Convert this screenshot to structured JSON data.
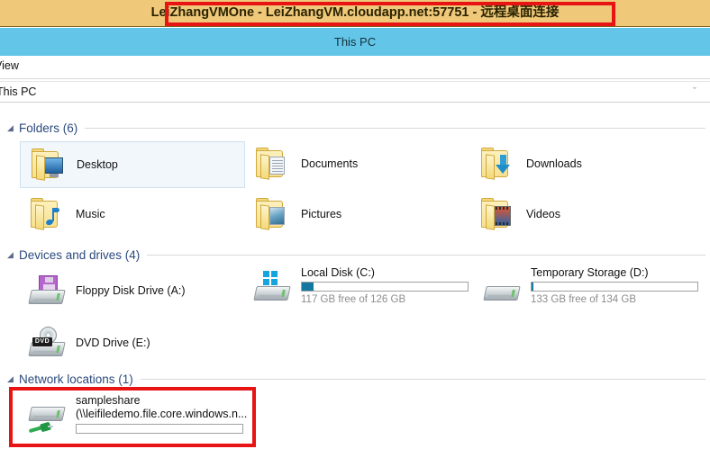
{
  "rdp": {
    "title": "LeiZhangVMOne - LeiZhangVM.cloudapp.net:57751 - 远程桌面连接",
    "highlight_color": "#e81414",
    "bar_color": "#efc87a"
  },
  "window": {
    "title": "This PC",
    "titlebar_color": "#63c6e8"
  },
  "ribbon": {
    "tab_label": "View"
  },
  "address_bar": {
    "path": "This PC",
    "chevron": "chevron-down-icon",
    "chevron_glyph": "ˇ"
  },
  "groups": [
    {
      "id": "folders",
      "label": "Folders (6)",
      "caret": "◢",
      "items": [
        {
          "name": "Desktop",
          "icon": "folder-desktop-icon",
          "selected": true
        },
        {
          "name": "Documents",
          "icon": "folder-documents-icon",
          "selected": false
        },
        {
          "name": "Downloads",
          "icon": "folder-downloads-icon",
          "selected": false
        },
        {
          "name": "Music",
          "icon": "folder-music-icon",
          "selected": false
        },
        {
          "name": "Pictures",
          "icon": "folder-pictures-icon",
          "selected": false
        },
        {
          "name": "Videos",
          "icon": "folder-videos-icon",
          "selected": false
        }
      ]
    },
    {
      "id": "devices",
      "label": "Devices and drives (4)",
      "caret": "◢",
      "items": [
        {
          "name": "Floppy Disk Drive (A:)",
          "icon": "floppy-drive-icon",
          "meter": false
        },
        {
          "name": "Local Disk (C:)",
          "icon": "local-disk-icon",
          "meter": true,
          "free_text": "117 GB free of 126 GB",
          "used_percent": 7,
          "fill_color": "#1477a0"
        },
        {
          "name": "Temporary Storage (D:)",
          "icon": "temp-storage-icon",
          "meter": true,
          "free_text": "133 GB free of 134 GB",
          "used_percent": 1,
          "fill_color": "#1477a0"
        },
        {
          "name": "DVD Drive (E:)",
          "icon": "dvd-drive-icon",
          "meter": false
        }
      ]
    },
    {
      "id": "network",
      "label": "Network locations (1)",
      "caret": "◢",
      "items": [
        {
          "name": "sampleshare",
          "subtitle": "(\\\\leifiledemo.file.core.windows.n...",
          "icon": "network-drive-icon",
          "meter": true,
          "used_percent": 0,
          "free_text": ""
        }
      ]
    }
  ],
  "dvd_tag_text": "DVD"
}
